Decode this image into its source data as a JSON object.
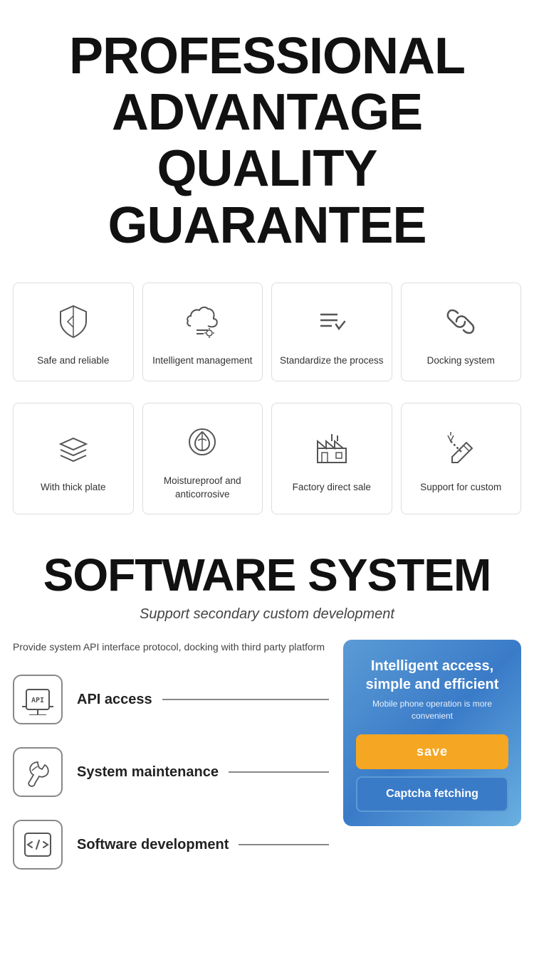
{
  "header": {
    "line1": "PROFESSIONAL",
    "line2": "ADVANTAGE",
    "line3": "QUALITY GUARANTEE"
  },
  "features_row1": [
    {
      "id": "safe-reliable",
      "label": "Safe and reliable",
      "icon": "shield"
    },
    {
      "id": "intelligent-management",
      "label": "Intelligent management",
      "icon": "cloud-settings"
    },
    {
      "id": "standardize-process",
      "label": "Standardize the process",
      "icon": "list-check"
    },
    {
      "id": "docking-system",
      "label": "Docking system",
      "icon": "link"
    }
  ],
  "features_row2": [
    {
      "id": "thick-plate",
      "label": "With thick plate",
      "icon": "layers"
    },
    {
      "id": "moistureproof",
      "label": "Moistureproof and anticorrosive",
      "icon": "shield-leaf"
    },
    {
      "id": "factory-sale",
      "label": "Factory direct sale",
      "icon": "factory"
    },
    {
      "id": "support-custom",
      "label": "Support for custom",
      "icon": "pencil-ruler"
    }
  ],
  "software": {
    "title": "SOFTWARE SYSTEM",
    "subtitle": "Support secondary custom development",
    "description": "Provide system API interface protocol, docking with third party platform",
    "items": [
      {
        "id": "api-access",
        "label": "API access",
        "icon": "api"
      },
      {
        "id": "system-maintenance",
        "label": "System maintenance",
        "icon": "wrench-drop"
      },
      {
        "id": "software-development",
        "label": "Software development",
        "icon": "code"
      }
    ],
    "panel": {
      "title": "Intelligent access, simple and efficient",
      "subtitle": "Mobile phone operation is more convenient",
      "save_btn": "save",
      "captcha_btn": "Captcha fetching"
    }
  }
}
